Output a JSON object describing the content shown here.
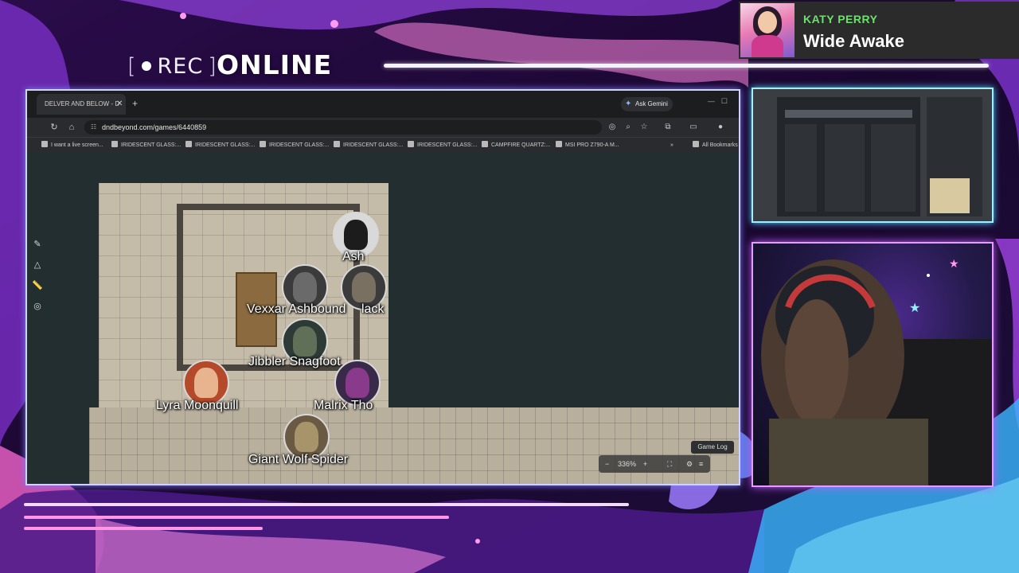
{
  "overlay": {
    "rec_label": "REC",
    "status_label": "ONLINE"
  },
  "now_playing": {
    "artist": "KATY PERRY",
    "title": "Wide Awake",
    "artist_color": "#6fe06f"
  },
  "browser": {
    "tab_title": "DELVER AND BELOW - D",
    "ask_gemini": "Ask Gemini",
    "url": "dndbeyond.com/games/6440859",
    "bookmarks": [
      "I want a live screen...",
      "IRIDESCENT GLASS:...",
      "IRIDESCENT GLASS:...",
      "IRIDESCENT GLASS:...",
      "IRIDESCENT GLASS:...",
      "IRIDESCENT GLASS:...",
      "CAMPFIRE QUARTZ:...",
      "MSI PRO Z790-A M..."
    ],
    "all_bookmarks": "All Bookmarks"
  },
  "map": {
    "tokens": [
      {
        "name": "Ash",
        "icon": "dragon-icon"
      },
      {
        "name": "Vexxar Ashbound",
        "icon": "armored-warrior-icon"
      },
      {
        "name": "lack",
        "icon": "armored-warrior-icon"
      },
      {
        "name": "Jibbler Snagfoot",
        "icon": "goblin-icon"
      },
      {
        "name": "Lyra Moonquill",
        "icon": "elf-portrait-icon"
      },
      {
        "name": "Malrix Tho",
        "icon": "tiefling-portrait-icon"
      },
      {
        "name": "Giant Wolf Spider",
        "icon": "spider-icon"
      }
    ],
    "zoom_level": "336%",
    "game_log_label": "Game Log"
  },
  "colors": {
    "main_frame_border": "#cfd4ff",
    "mini_frame_border": "#9ef0ff",
    "cam_frame_border": "#e69cff"
  }
}
